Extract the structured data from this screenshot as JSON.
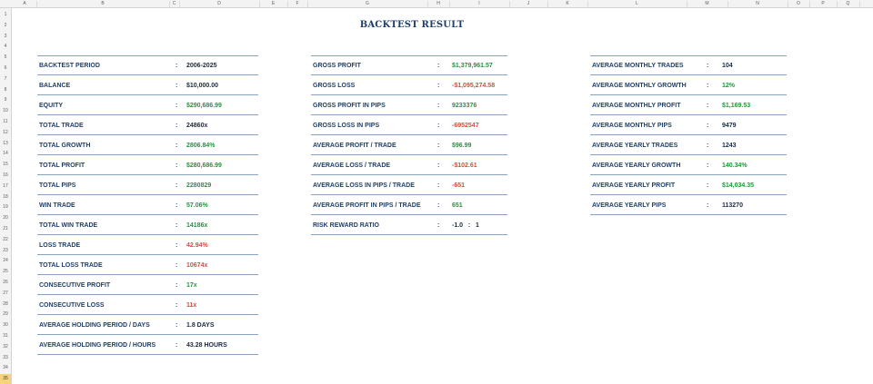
{
  "colors": {
    "positive": "#1c9a3a",
    "negative": "#e0463a",
    "neutral": "#1a2a44",
    "heading": "#1f3e6b"
  },
  "sheet": {
    "columns": [
      "A",
      "B",
      "C",
      "D",
      "E",
      "F",
      "G",
      "H",
      "I",
      "J",
      "K",
      "L",
      "M",
      "N",
      "O",
      "P",
      "Q"
    ],
    "rows": [
      "1",
      "2",
      "3",
      "4",
      "5",
      "6",
      "7",
      "8",
      "9",
      "10",
      "11",
      "12",
      "13",
      "14",
      "15",
      "16",
      "17",
      "18",
      "19",
      "20",
      "21",
      "22",
      "23",
      "24",
      "25",
      "26",
      "27",
      "28",
      "29",
      "30",
      "31",
      "32",
      "33",
      "34",
      "35"
    ],
    "selected_row": "35"
  },
  "title": "BACKTEST RESULT",
  "panels": [
    {
      "rows": [
        {
          "label": "BACKTEST PERIOD",
          "value": "2006-2025",
          "tone": "neutral"
        },
        {
          "label": "BALANCE",
          "value": "$10,000.00",
          "tone": "neutral"
        },
        {
          "label": "EQUITY",
          "value": "$290,686.99",
          "tone": "positive"
        },
        {
          "label": "TOTAL TRADE",
          "value": "24860x",
          "tone": "neutral"
        },
        {
          "label": "TOTAL GROWTH",
          "value": "2806.84%",
          "tone": "positive"
        },
        {
          "label": "TOTAL PROFIT",
          "value": "$280,686.99",
          "tone": "positive"
        },
        {
          "label": "TOTAL PIPS",
          "value": "2280829",
          "tone": "positive"
        },
        {
          "label": "WIN TRADE",
          "value": "57.06%",
          "tone": "positive"
        },
        {
          "label": "TOTAL WIN TRADE",
          "value": "14186x",
          "tone": "positive"
        },
        {
          "label": "LOSS TRADE",
          "value": "42.94%",
          "tone": "negative"
        },
        {
          "label": "TOTAL LOSS TRADE",
          "value": "10674x",
          "tone": "negative"
        },
        {
          "label": "CONSECUTIVE PROFIT",
          "value": "17x",
          "tone": "positive"
        },
        {
          "label": "CONSECUTIVE LOSS",
          "value": "11x",
          "tone": "negative"
        },
        {
          "label": "AVERAGE HOLDING PERIOD / DAYS",
          "value": "1.8 DAYS",
          "tone": "neutral"
        },
        {
          "label": "AVERAGE HOLDING PERIOD / HOURS",
          "value": "43.28 HOURS",
          "tone": "neutral"
        }
      ]
    },
    {
      "rows": [
        {
          "label": "GROSS PROFIT",
          "value": "$1,379,961.57",
          "tone": "positive"
        },
        {
          "label": "GROSS LOSS",
          "value": "-$1,095,274.58",
          "tone": "negative"
        },
        {
          "label": "GROSS PROFIT IN PIPS",
          "value": "9233376",
          "tone": "positive"
        },
        {
          "label": "GROSS LOSS IN PIPS",
          "value": "-6952547",
          "tone": "negative"
        },
        {
          "label": "AVERAGE PROFIT / TRADE",
          "value": "$96.99",
          "tone": "positive"
        },
        {
          "label": "AVERAGE LOSS / TRADE",
          "value": "-$102.61",
          "tone": "negative"
        },
        {
          "label": "AVERAGE LOSS IN PIPS / TRADE",
          "value": "-651",
          "tone": "negative"
        },
        {
          "label": "AVERAGE PROFIT IN PIPS / TRADE",
          "value": "651",
          "tone": "positive"
        },
        {
          "label": "RISK REWARD RATIO",
          "value": "-1.0   :   1",
          "tone": "neutral"
        }
      ]
    },
    {
      "rows": [
        {
          "label": "AVERAGE MONTHLY TRADES",
          "value": "104",
          "tone": "neutral"
        },
        {
          "label": "AVERAGE MONTHLY GROWTH",
          "value": "12%",
          "tone": "positive"
        },
        {
          "label": "AVERAGE MONTHLY PROFIT",
          "value": "$1,169.53",
          "tone": "positive"
        },
        {
          "label": "AVERAGE MONTHLY PIPS",
          "value": "9479",
          "tone": "neutral"
        },
        {
          "label": "AVERAGE YEARLY TRADES",
          "value": "1243",
          "tone": "neutral"
        },
        {
          "label": "AVERAGE YEARLY GROWTH",
          "value": "140.34%",
          "tone": "positive"
        },
        {
          "label": "AVERAGE YEARLY PROFIT",
          "value": "$14,034.35",
          "tone": "positive"
        },
        {
          "label": "AVERAGE YEARLY PIPS",
          "value": "113270",
          "tone": "neutral"
        }
      ]
    }
  ]
}
